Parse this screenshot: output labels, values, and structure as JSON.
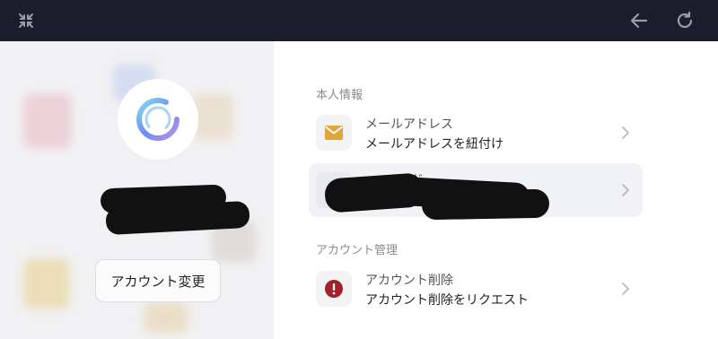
{
  "left": {
    "switch_account": "アカウント変更"
  },
  "sections": {
    "personal": {
      "title": "本人情報",
      "email": {
        "title": "メールアドレス",
        "subtitle": "メールアドレスを紐付け",
        "icon": "mail-icon"
      },
      "password": {
        "title": "ード",
        "icon": "lock-icon"
      }
    },
    "account": {
      "title": "アカウント管理",
      "delete": {
        "title": "アカウント削除",
        "subtitle": "アカウント削除をリクエスト",
        "icon": "alert-icon"
      }
    }
  },
  "colors": {
    "topbar": "#1b1d2b",
    "mail_icon": "#e0a63a",
    "lock_icon": "#e0a63a",
    "alert_icon": "#a3222a"
  }
}
